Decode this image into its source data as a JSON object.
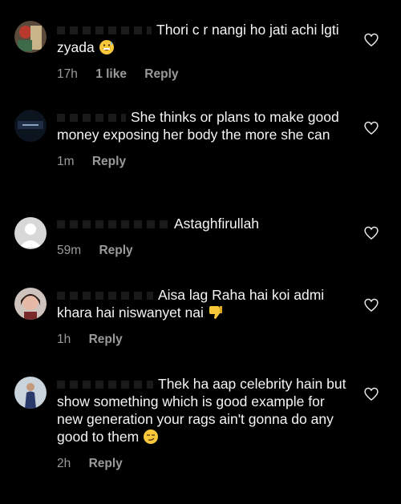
{
  "comments": [
    {
      "text": "Thori c r nangi ho jati achi lgti zyada",
      "emoji": "grinning-sweat-emoji",
      "time": "17h",
      "likes": "1 like",
      "reply": "Reply"
    },
    {
      "text": "She thinks or plans to make good money exposing her body the more she can",
      "time": "1m",
      "reply": "Reply"
    },
    {
      "text": "Astaghfirullah",
      "time": "59m",
      "reply": "Reply"
    },
    {
      "text": "Aisa lag Raha hai koi admi khara hai niswanyet nai",
      "emoji": "thumbs-down-emoji",
      "time": "1h",
      "reply": "Reply"
    },
    {
      "text": "Thek ha aap celebrity hain but show something which is good example for new generation your rags ain't gonna do any good to them",
      "emoji": "smirk-emoji",
      "time": "2h",
      "reply": "Reply"
    }
  ],
  "colors": {
    "background": "#000000",
    "text": "#f5f5f5",
    "meta": "#9a9a9a"
  }
}
